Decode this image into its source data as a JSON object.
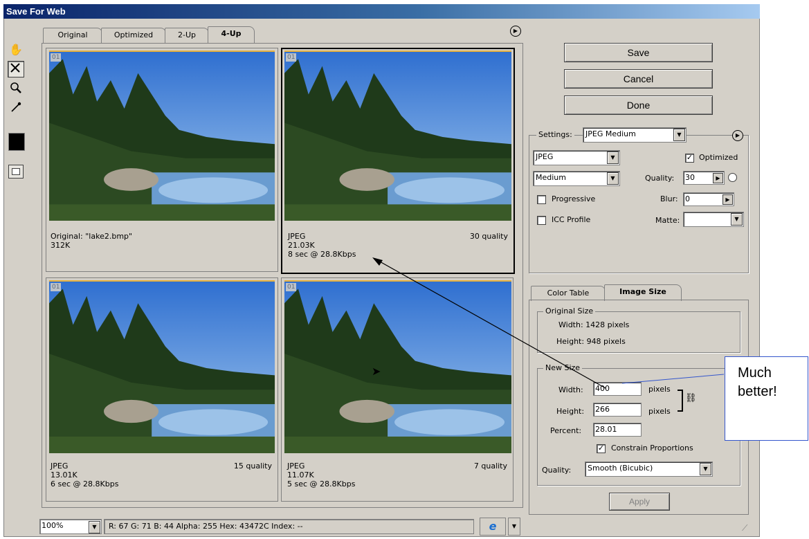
{
  "window": {
    "title": "Save For Web"
  },
  "tabs": [
    {
      "label": "Original",
      "active": false
    },
    {
      "label": "Optimized",
      "active": false
    },
    {
      "label": "2-Up",
      "active": false
    },
    {
      "label": "4-Up",
      "active": true
    }
  ],
  "tools": [
    "hand-icon",
    "slice-select-icon",
    "zoom-icon",
    "eyedropper-icon"
  ],
  "panes": [
    {
      "badge": "01",
      "line1_left": "Original: \"lake2.bmp\"",
      "line1_right": "",
      "line2": "312K",
      "line3": ""
    },
    {
      "badge": "01",
      "line1_left": "JPEG",
      "line1_right": "30 quality",
      "line2": "21.03K",
      "line3": "8 sec @ 28.8Kbps"
    },
    {
      "badge": "01",
      "line1_left": "JPEG",
      "line1_right": "15 quality",
      "line2": "13.01K",
      "line3": "6 sec @ 28.8Kbps"
    },
    {
      "badge": "01",
      "line1_left": "JPEG",
      "line1_right": "7 quality",
      "line2": "11.07K",
      "line3": "5 sec @ 28.8Kbps"
    }
  ],
  "buttons": {
    "save": "Save",
    "cancel": "Cancel",
    "done": "Done",
    "apply": "Apply"
  },
  "settings": {
    "label": "Settings:",
    "preset": "JPEG Medium",
    "format": "JPEG",
    "quality_preset": "Medium",
    "optimized_label": "Optimized",
    "optimized_checked": true,
    "quality_label": "Quality:",
    "quality_value": "30",
    "progressive_label": "Progressive",
    "progressive_checked": false,
    "blur_label": "Blur:",
    "blur_value": "0",
    "icc_label": "ICC Profile",
    "icc_checked": false,
    "matte_label": "Matte:",
    "matte_value": ""
  },
  "lower_tabs": [
    {
      "label": "Color Table",
      "active": false
    },
    {
      "label": "Image Size",
      "active": true
    }
  ],
  "image_size": {
    "original_title": "Original Size",
    "orig_width": "Width: 1428 pixels",
    "orig_height": "Height: 948 pixels",
    "new_title": "New Size",
    "width_label": "Width:",
    "width_value": "400",
    "height_label": "Height:",
    "height_value": "266",
    "unit": "pixels",
    "percent_label": "Percent:",
    "percent_value": "28.01",
    "constrain_label": "Constrain Proportions",
    "constrain_checked": true,
    "quality_label": "Quality:",
    "quality_value": "Smooth (Bicubic)"
  },
  "status": {
    "zoom": "100%",
    "readout": "R:  67  G:  71  B:  44  Alpha: 255  Hex:  43472C  Index:    --"
  },
  "callout": {
    "line1": "Much",
    "line2": "better!"
  },
  "colors": {
    "foreground_swatch": "#000000",
    "title_bar": "#0a246a"
  }
}
